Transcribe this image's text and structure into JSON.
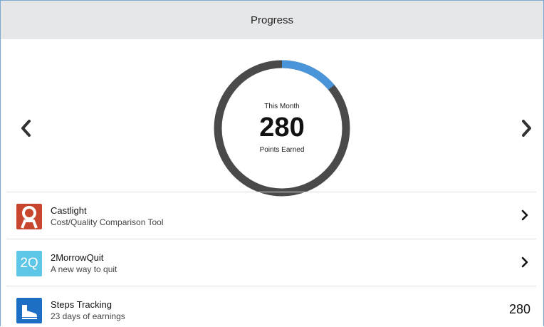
{
  "header": {
    "title": "Progress"
  },
  "summary": {
    "caption_top": "This Month",
    "value": "280",
    "caption_bottom": "Points Earned",
    "progress_fraction": 0.14,
    "progress_color": "#4a95d9",
    "track_color": "#4a4a4a"
  },
  "nav": {
    "prev_icon": "chevron-left-icon",
    "next_icon": "chevron-right-icon"
  },
  "apps": [
    {
      "title": "Castlight",
      "subtitle": "Cost/Quality Comparison Tool",
      "icon": "castlight-logo-icon",
      "icon_color": "#c8462d"
    },
    {
      "title": "2MorrowQuit",
      "subtitle": "A new way to quit",
      "icon_text": "2Q",
      "icon_color": "#5ec6e6"
    },
    {
      "title": "Steps Tracking",
      "subtitle": "23 days of earnings",
      "value": "280",
      "icon": "shoe-icon",
      "icon_color": "#1c6fc4"
    }
  ]
}
